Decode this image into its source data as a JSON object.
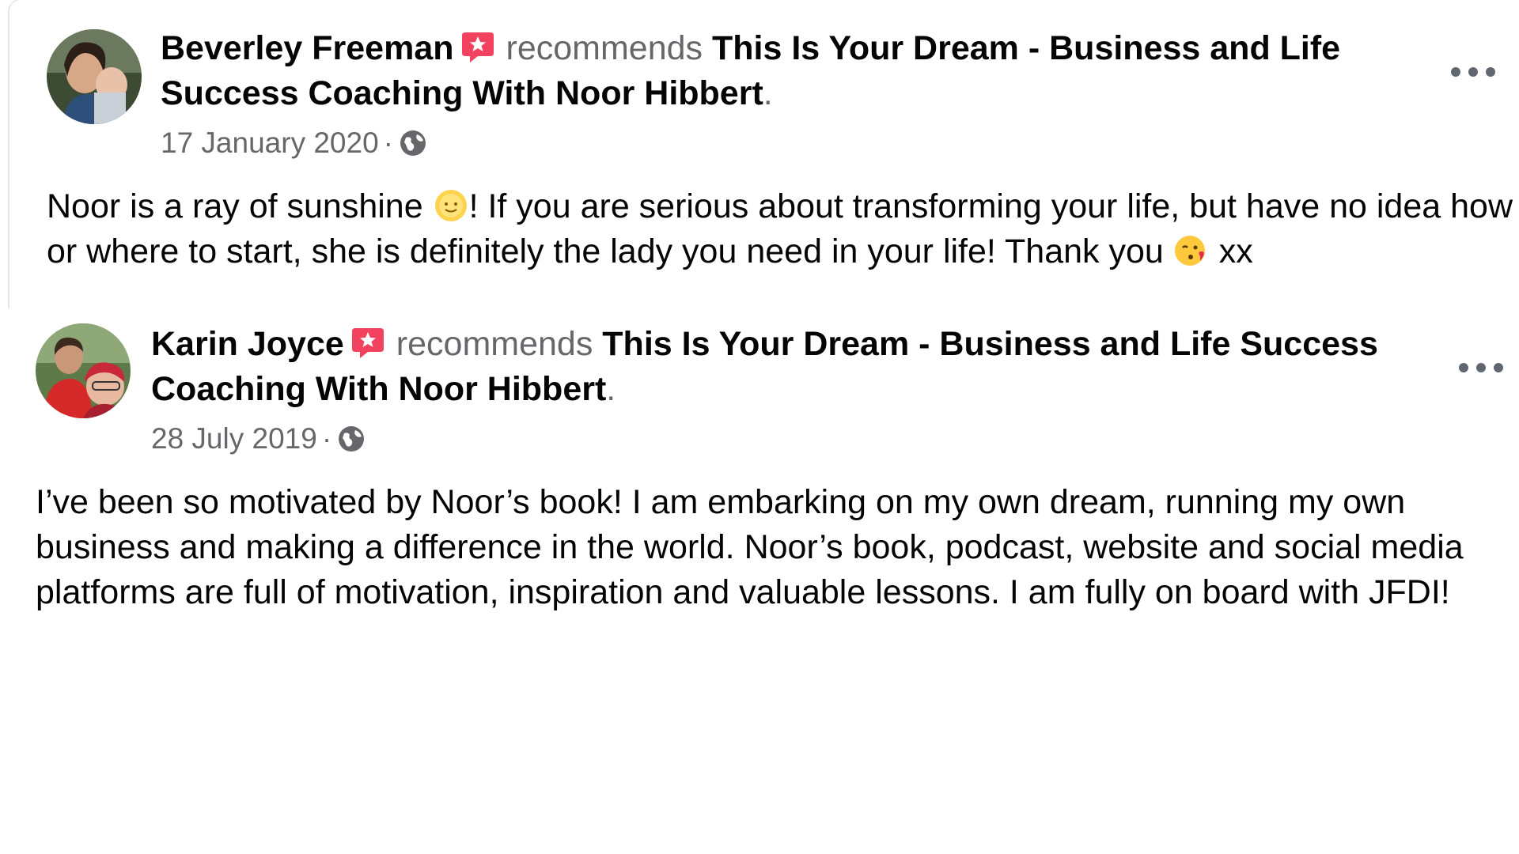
{
  "posts": [
    {
      "author": "Beverley Freeman",
      "action": "recommends",
      "page": "This Is Your Dream - Business and Life Success Coaching With Noor Hibbert",
      "page_suffix": ".",
      "date": "17 January 2020",
      "separator": "·",
      "text_before_emoji_1": "Noor is a ray of sunshine ",
      "text_after_emoji_1": "! If you are serious about transforming your life, but have no idea how or where to start, she is definitely the lady you need in your life! Thank you ",
      "text_after_emoji_2": " xx",
      "emoji_1": "sun-face-emoji",
      "emoji_2": "blowing-kiss-emoji",
      "icons": [
        "recommend-badge-icon",
        "globe-icon",
        "more-options-icon"
      ]
    },
    {
      "author": "Karin Joyce",
      "action": "recommends",
      "page": "This Is Your Dream - Business and Life Success Coaching With Noor Hibbert",
      "page_suffix": ".",
      "date": "28 July 2019",
      "separator": "·",
      "text": "I’ve been so motivated by Noor’s book! I am embarking on my own dream, running my own business and making a difference in the world. Noor’s book, podcast, website and social media platforms are full of motivation, inspiration and valuable lessons. I am fully on board with JFDI!",
      "icons": [
        "recommend-badge-icon",
        "globe-icon",
        "more-options-icon"
      ]
    }
  ],
  "colors": {
    "text_primary": "#050505",
    "text_secondary": "#65676b",
    "badge": "#f3425f",
    "card_border": "#e4e6eb"
  }
}
